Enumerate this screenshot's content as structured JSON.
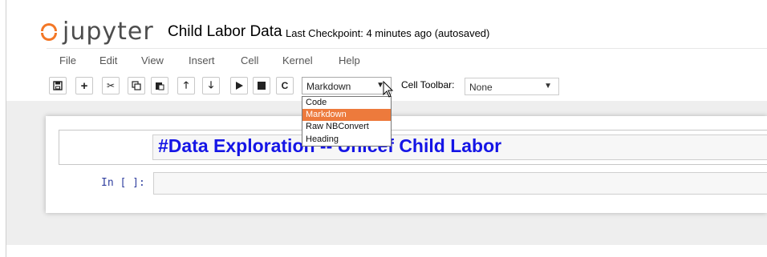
{
  "header": {
    "logo_text": "jupyter",
    "notebook_name": "Child Labor Data",
    "checkpoint": "Last Checkpoint: 4 minutes ago (autosaved)"
  },
  "menu": [
    "File",
    "Edit",
    "View",
    "Insert",
    "Cell",
    "Kernel",
    "Help"
  ],
  "toolbar": {
    "buttons": [
      {
        "name": "save-icon"
      },
      {
        "name": "plus-icon"
      },
      {
        "name": "cut-icon"
      },
      {
        "name": "copy-icon"
      },
      {
        "name": "paste-icon"
      },
      {
        "name": "arrow-up-icon"
      },
      {
        "name": "arrow-down-icon"
      },
      {
        "name": "run-icon"
      },
      {
        "name": "stop-icon"
      },
      {
        "name": "restart-icon"
      }
    ],
    "cell_type_value": "Markdown",
    "cell_toolbar_label": "Cell Toolbar:",
    "cell_toolbar_value": "None"
  },
  "dropdown": {
    "options": [
      "Code",
      "Markdown",
      "Raw NBConvert",
      "Heading"
    ],
    "selected": "Markdown"
  },
  "cells": {
    "markdown_text": "#Data Exploration -- Unicef Child Labor",
    "code_prompt": "In [ ]:"
  },
  "colors": {
    "accent_orange": "#f37726",
    "dropdown_highlight": "#ed7a3c",
    "markdown_text": "#1515e6",
    "prompt": "#303f9f"
  }
}
